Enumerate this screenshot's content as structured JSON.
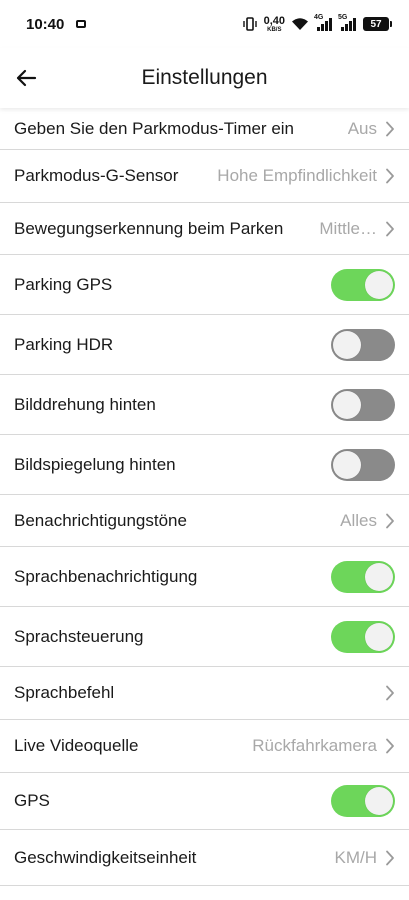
{
  "status_bar": {
    "time": "10:40",
    "net_speed_value": "0,40",
    "net_speed_unit": "KB/S",
    "signal_1_label": "4G",
    "signal_2_label": "5G",
    "battery_level": "57"
  },
  "header": {
    "title": "Einstellungen"
  },
  "settings": [
    {
      "label": "Geben Sie den Parkmodus-Timer ein",
      "type": "value",
      "value": "Aus"
    },
    {
      "label": "Parkmodus-G-Sensor",
      "type": "value",
      "value": "Hohe Empfindlichkeit"
    },
    {
      "label": "Bewegungserkennung beim Parken",
      "type": "value",
      "value": "Mittle…"
    },
    {
      "label": "Parking GPS",
      "type": "toggle",
      "on": true
    },
    {
      "label": "Parking HDR",
      "type": "toggle",
      "on": false
    },
    {
      "label": "Bilddrehung hinten",
      "type": "toggle",
      "on": false
    },
    {
      "label": "Bildspiegelung hinten",
      "type": "toggle",
      "on": false
    },
    {
      "label": "Benachrichtigungstöne",
      "type": "value",
      "value": "Alles"
    },
    {
      "label": "Sprachbenachrichtigung",
      "type": "toggle",
      "on": true
    },
    {
      "label": "Sprachsteuerung",
      "type": "toggle",
      "on": true
    },
    {
      "label": "Sprachbefehl",
      "type": "value",
      "value": ""
    },
    {
      "label": "Live Videoquelle",
      "type": "value",
      "value": "Rückfahrkamera"
    },
    {
      "label": "GPS",
      "type": "toggle",
      "on": true
    },
    {
      "label": "Geschwindigkeitseinheit",
      "type": "value",
      "value": "KM/H"
    }
  ],
  "colors": {
    "toggle_on": "#6dd65a",
    "toggle_off": "#8a8a8a",
    "value_text": "#a8a8a8"
  }
}
